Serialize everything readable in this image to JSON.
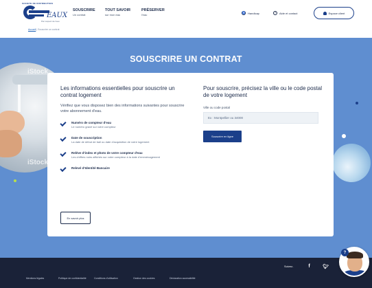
{
  "header": {
    "logo": {
      "top_text": "SOCIETE DE DISTRIBUTION",
      "word": "EAUX",
      "tagline": "Par respect de l'eau"
    },
    "nav": [
      {
        "title": "SOUSCRIRE",
        "sub": "Un contrat"
      },
      {
        "title": "TOUT SAVOIR",
        "sub": "sur mon eau"
      },
      {
        "title": "PRÉSERVER",
        "sub": "l'eau"
      }
    ],
    "handicap": "Handicap",
    "contact": "Aide et contact",
    "espace_client": "Espace client"
  },
  "breadcrumb": {
    "home": "Accueil",
    "current": "| Souscrire un contrat"
  },
  "hero": {
    "title": "SOUSCRIRE UN CONTRAT",
    "watermark": "iStock"
  },
  "card": {
    "left": {
      "heading": "Les informations essentielles pour souscrire un contrat logement",
      "intro": "Vérifiez que vous disposez bien des informations suivantes pour souscrire votre abonnement d'eau.",
      "items": [
        {
          "title": "Numéro de compteur d'eau",
          "desc": "Le numéro gravé sur votre compteur"
        },
        {
          "title": "Date de souscription",
          "desc": "La date de début de bail ou date d'acquisition de votre logement"
        },
        {
          "title": "Relève d'index et photo de votre compteur d'eau",
          "desc": "Les chiffres noirs affichés sur votre compteur à la date d'emménagement"
        },
        {
          "title": "Relevé d'Identité Bancaire",
          "desc": ""
        }
      ],
      "more_button": "En savoir plus"
    },
    "right": {
      "heading": "Pour souscrire, précisez la ville ou le code postal de votre logement",
      "field_label": "Ville ou code postal",
      "field_value": "Ex : Montpellier ou 34000",
      "submit": "Souscrire en ligne"
    }
  },
  "footer": {
    "suivez": "Suivez-",
    "links": [
      "Mentions légales",
      "Politique de confidentialité",
      "Conditions d'utilisation",
      "Gestion des cookies",
      "Déclaration accessibilité"
    ]
  },
  "chat": {
    "badge": "?"
  },
  "colors": {
    "primary": "#1b3f8a",
    "hero": "#5f8ed0",
    "footer": "#1a2238"
  }
}
